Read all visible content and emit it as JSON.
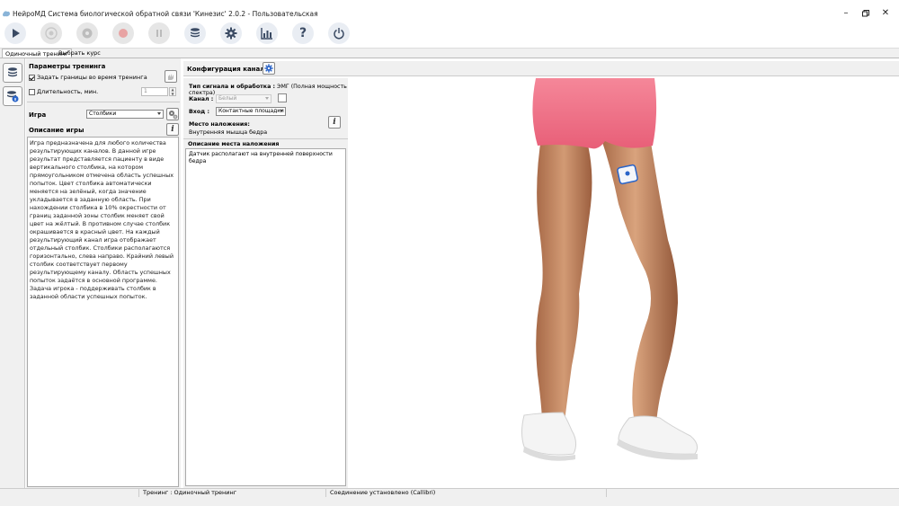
{
  "window": {
    "title": "НейроМД Система биологической обратной связи 'Кинезис' 2.0.2 - Пользовательская",
    "controls": [
      "minimize-icon",
      "restore-icon",
      "close-icon"
    ]
  },
  "toolbar": {
    "buttons": [
      {
        "icon": "play-icon",
        "enabled": true
      },
      {
        "icon": "target-icon",
        "enabled": false
      },
      {
        "icon": "gear-disabled-icon",
        "enabled": false
      },
      {
        "icon": "record-icon",
        "enabled": false
      },
      {
        "icon": "pause-icon",
        "enabled": false
      },
      {
        "icon": "database-icon",
        "enabled": true
      },
      {
        "icon": "settings-icon",
        "enabled": true
      },
      {
        "icon": "chart-icon",
        "enabled": true
      },
      {
        "icon": "help-icon",
        "enabled": true
      },
      {
        "icon": "power-icon",
        "enabled": true
      }
    ]
  },
  "tabs": [
    "Одиночный тренинг",
    "Выбрать курс"
  ],
  "training_params": {
    "title": "Параметры тренинга",
    "set_bounds_label": "Задать границы во время тренинга",
    "set_bounds_checked": true,
    "duration_label": "Длительность, мин.",
    "duration_checked": false,
    "duration_value": "1"
  },
  "game": {
    "label": "Игра",
    "selected": "Столбики",
    "description_title": "Описание игры",
    "description": "Игра предназначена для любого количества результирующих каналов. В данной игре результат представляется пациенту в виде вертикального столбика, на котором прямоугольником отмечена область успешных попыток. Цвет столбика автоматически меняется на зелёный, когда значение укладывается в заданную область. При нахождении столбика в 10% окрестности от границ заданной зоны столбик меняет свой цвет на жёлтый. В противном случае столбик окрашивается в красный цвет. На каждый результирующий канал игра отображает отдельный столбик. Столбики располагаются горизонтально, слева направо. Крайний левый столбик соответствует первому результирующему каналу. Область успешных попыток задаётся в основной программе. Задача игрока - поддерживать столбик в заданной области успешных попыток."
  },
  "channel_config": {
    "title": "Конфигурация каналов",
    "signal_type_label": "Тип сигнала и обработка :",
    "signal_type_value": "ЭМГ (Полная мощность спектра)",
    "channel_label": "Канал :",
    "channel_value": "Белый",
    "input_label": "Вход :",
    "input_value": "Контактные площадки",
    "placement_label": "Место наложения:",
    "placement_value": "Внутренняя мышца бедра",
    "placement_desc_title": "Описание места наложения",
    "placement_desc": "Датчик располагают на внутренней поверхности бедра"
  },
  "status": {
    "training": "Тренинг : Одиночный тренинг",
    "connection": "Соединение установлено (Callibri)"
  },
  "colors": {
    "accent_blue": "#2a64c8",
    "record_red": "#e05a5a",
    "skin": "#c98a65",
    "shorts": "#f2738a"
  }
}
